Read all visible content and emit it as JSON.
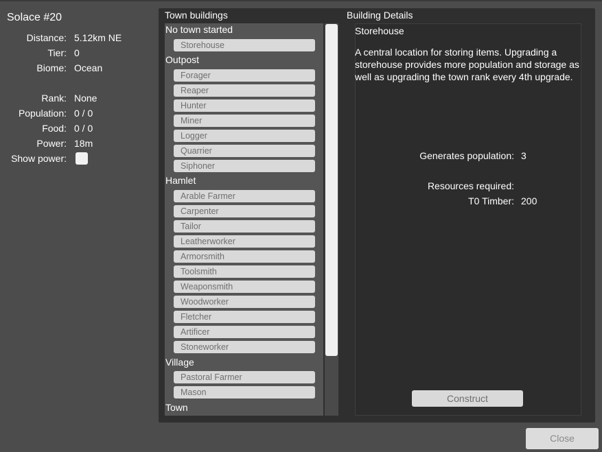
{
  "window": {
    "title": "Solace #20"
  },
  "info": [
    {
      "label": "Distance:",
      "value": "5.12km NE"
    },
    {
      "label": "Tier:",
      "value": "0"
    },
    {
      "label": "Biome:",
      "value": "Ocean"
    },
    {
      "label": "Rank:",
      "value": "None"
    },
    {
      "label": "Population:",
      "value": "0 / 0"
    },
    {
      "label": "Food:",
      "value": "0 / 0"
    },
    {
      "label": "Power:",
      "value": "18m"
    },
    {
      "label": "Show power:",
      "value": ""
    }
  ],
  "town_buildings": {
    "header": "Town buildings",
    "categories": [
      {
        "name": "No town started",
        "buildings": [
          "Storehouse"
        ]
      },
      {
        "name": "Outpost",
        "buildings": [
          "Forager",
          "Reaper",
          "Hunter",
          "Miner",
          "Logger",
          "Quarrier",
          "Siphoner"
        ]
      },
      {
        "name": "Hamlet",
        "buildings": [
          "Arable Farmer",
          "Carpenter",
          "Tailor",
          "Leatherworker",
          "Armorsmith",
          "Toolsmith",
          "Weaponsmith",
          "Woodworker",
          "Fletcher",
          "Artificer",
          "Stoneworker"
        ]
      },
      {
        "name": "Village",
        "buildings": [
          "Pastoral Farmer",
          "Mason"
        ]
      },
      {
        "name": "Town",
        "buildings": []
      }
    ]
  },
  "details": {
    "header": "Building Details",
    "title": "Storehouse",
    "description": "A central location for storing items. Upgrading a storehouse provides more population and storage as well as upgrading the town rank every 4th upgrade.",
    "generates_label": "Generates population:",
    "generates_value": "3",
    "resources_label": "Resources required:",
    "resource_name": "T0 Timber:",
    "resource_value": "200",
    "construct_label": "Construct"
  },
  "close_label": "Close"
}
